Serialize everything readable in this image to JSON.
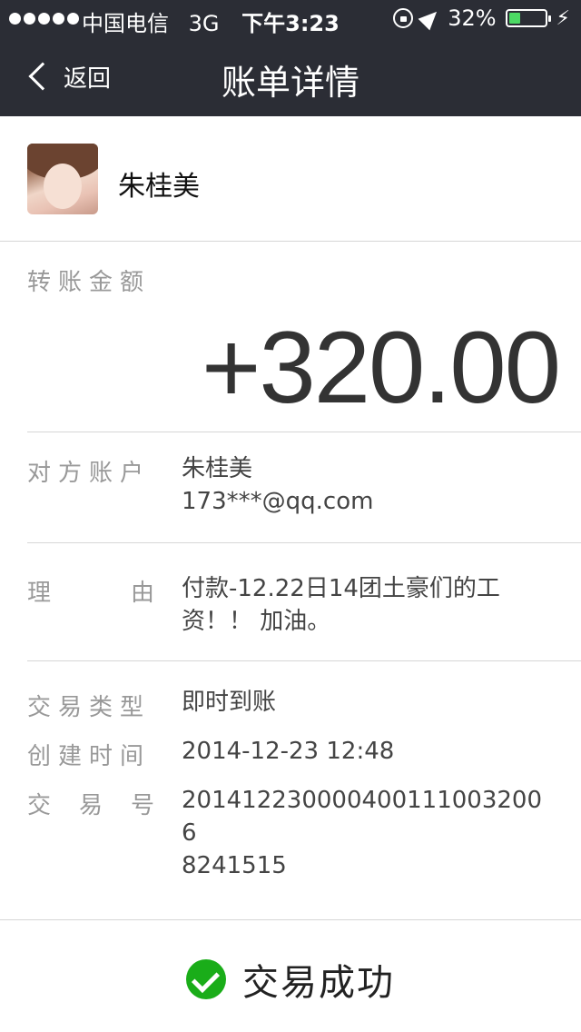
{
  "status_bar": {
    "carrier": "中国电信",
    "network": "3G",
    "time": "下午3:23",
    "battery": "32%",
    "battery_level": 0.32,
    "battery_color": "#4cd964"
  },
  "nav": {
    "back_label": "返回",
    "title": "账单详情",
    "bg_color": "#2b2d35"
  },
  "payer": {
    "name": "朱桂美"
  },
  "amount": {
    "label": "转账金额",
    "value": "+320.00"
  },
  "details": {
    "counterparty_label": "对方账户",
    "counterparty_name": "朱桂美",
    "counterparty_account": "173***@qq.com",
    "reason_label_chars": [
      "理",
      "由"
    ],
    "reason": "付款-12.22日14团土豪们的工资！！ 加油。",
    "type_label": "交易类型",
    "type_value": "即时到账",
    "created_label": "创建时间",
    "created_value": "2014-12-23 12:48",
    "txn_label_chars": [
      "交",
      "易",
      "号"
    ],
    "txn_line1": "201412230000400111003200​6",
    "txn_line2": "8241515"
  },
  "footer": {
    "status_text": "交易成功",
    "status_icon": "check-circle-icon",
    "accent_color": "#1aad19"
  }
}
